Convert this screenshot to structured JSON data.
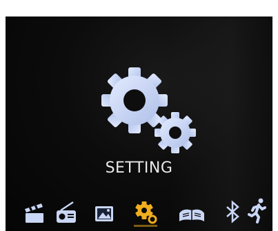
{
  "screen": {
    "title": "SETTING"
  },
  "menu": {
    "active_index": 3,
    "accent_color": "#F0AE1E",
    "icon_color": "#C9D6F5",
    "items": [
      {
        "icon": "film-clapper-icon"
      },
      {
        "icon": "radio-icon"
      },
      {
        "icon": "photo-icon"
      },
      {
        "icon": "settings-gear-icon"
      },
      {
        "icon": "book-icon"
      },
      {
        "icon": "bluetooth-icon"
      },
      {
        "icon": "runner-icon"
      }
    ]
  }
}
